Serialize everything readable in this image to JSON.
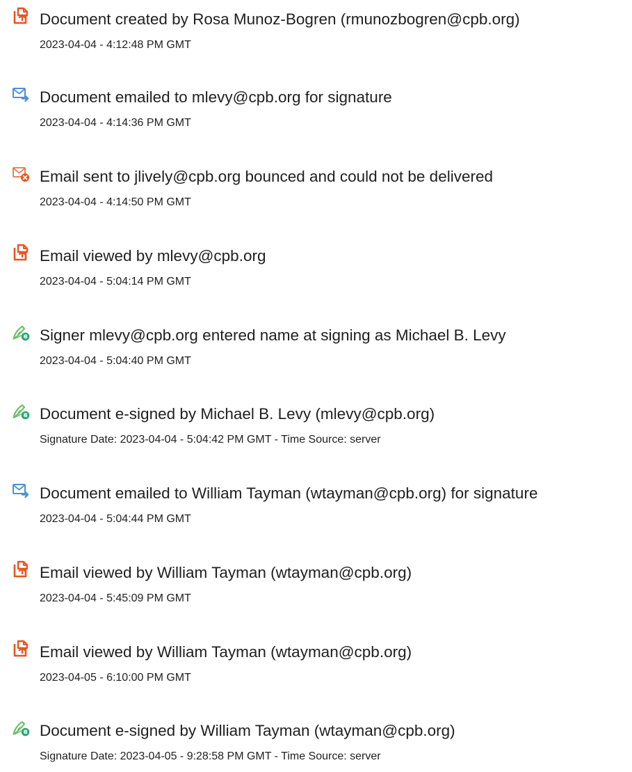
{
  "colors": {
    "document_icon": "#e8541e",
    "email_icon": "#4a90d9",
    "bounce_badge": "#e8541e",
    "sign_icon": "#6abf69",
    "sign_badge": "#2aa876"
  },
  "events": [
    {
      "icon": "document-icon",
      "title": "Document created by Rosa Munoz-Bogren (rmunozbogren@cpb.org)",
      "detail": "2023-04-04 - 4:12:48 PM GMT"
    },
    {
      "icon": "email-sent-icon",
      "title": "Document emailed to mlevy@cpb.org for signature",
      "detail": "2023-04-04 - 4:14:36 PM GMT"
    },
    {
      "icon": "email-bounced-icon",
      "title": "Email sent to jlively@cpb.org bounced and could not be delivered",
      "detail": "2023-04-04 - 4:14:50 PM GMT"
    },
    {
      "icon": "document-icon",
      "title": "Email viewed by mlevy@cpb.org",
      "detail": "2023-04-04 - 5:04:14 PM GMT"
    },
    {
      "icon": "signature-icon",
      "title": "Signer mlevy@cpb.org entered name at signing as Michael B. Levy",
      "detail": "2023-04-04 - 5:04:40 PM GMT"
    },
    {
      "icon": "signature-icon",
      "title": "Document e-signed by Michael B. Levy (mlevy@cpb.org)",
      "detail": "Signature Date: 2023-04-04 - 5:04:42 PM GMT - Time Source: server"
    },
    {
      "icon": "email-sent-icon",
      "title": "Document emailed to William Tayman (wtayman@cpb.org) for signature",
      "detail": "2023-04-04 - 5:04:44 PM GMT"
    },
    {
      "icon": "document-icon",
      "title": "Email viewed by William Tayman (wtayman@cpb.org)",
      "detail": "2023-04-04 - 5:45:09 PM GMT"
    },
    {
      "icon": "document-icon",
      "title": "Email viewed by William Tayman (wtayman@cpb.org)",
      "detail": "2023-04-05 - 6:10:00 PM GMT"
    },
    {
      "icon": "signature-icon",
      "title": "Document e-signed by William Tayman (wtayman@cpb.org)",
      "detail": "Signature Date: 2023-04-05 - 9:28:58 PM GMT - Time Source: server"
    }
  ]
}
